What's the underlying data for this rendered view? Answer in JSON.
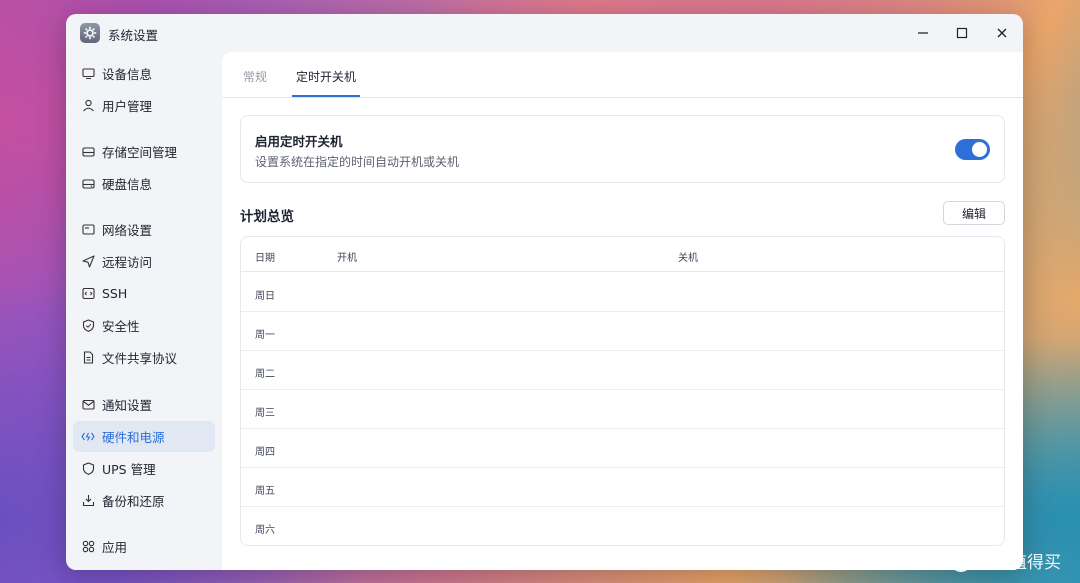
{
  "window": {
    "title": "系统设置",
    "app_icon": "gear-icon"
  },
  "sidebar": {
    "items": [
      {
        "label": "设备信息",
        "icon": "monitor-icon",
        "active": false
      },
      {
        "label": "用户管理",
        "icon": "user-icon",
        "active": false
      },
      {
        "label": "存储空间管理",
        "icon": "drive-icon",
        "active": false
      },
      {
        "label": "硬盘信息",
        "icon": "disk-icon",
        "active": false
      },
      {
        "label": "网络设置",
        "icon": "network-icon",
        "active": false
      },
      {
        "label": "远程访问",
        "icon": "send-icon",
        "active": false
      },
      {
        "label": "SSH",
        "icon": "terminal-icon",
        "active": false
      },
      {
        "label": "安全性",
        "icon": "shield-icon",
        "active": false
      },
      {
        "label": "文件共享协议",
        "icon": "file-icon",
        "active": false
      },
      {
        "label": "通知设置",
        "icon": "mail-icon",
        "active": false
      },
      {
        "label": "硬件和电源",
        "icon": "hardware-icon",
        "active": true
      },
      {
        "label": "UPS 管理",
        "icon": "ups-shield-icon",
        "active": false
      },
      {
        "label": "备份和还原",
        "icon": "backup-icon",
        "active": false
      },
      {
        "label": "应用",
        "icon": "apps-icon",
        "active": false
      }
    ]
  },
  "tabs": [
    {
      "label": "常规",
      "active": false
    },
    {
      "label": "定时开关机",
      "active": true
    }
  ],
  "schedule_card": {
    "title": "启用定时开关机",
    "description": "设置系统在指定的时间自动开机或关机",
    "enabled": true
  },
  "overview": {
    "title": "计划总览",
    "edit_label": "编辑",
    "columns": [
      "日期",
      "开机",
      "关机"
    ],
    "rows": [
      "周日",
      "周一",
      "周二",
      "周三",
      "周四",
      "周五",
      "周六"
    ]
  },
  "watermark": {
    "text": "什么值得买",
    "icon_char": "值"
  },
  "colors": {
    "accent": "#2e6fd8",
    "active_bg": "#e2e8f3"
  }
}
